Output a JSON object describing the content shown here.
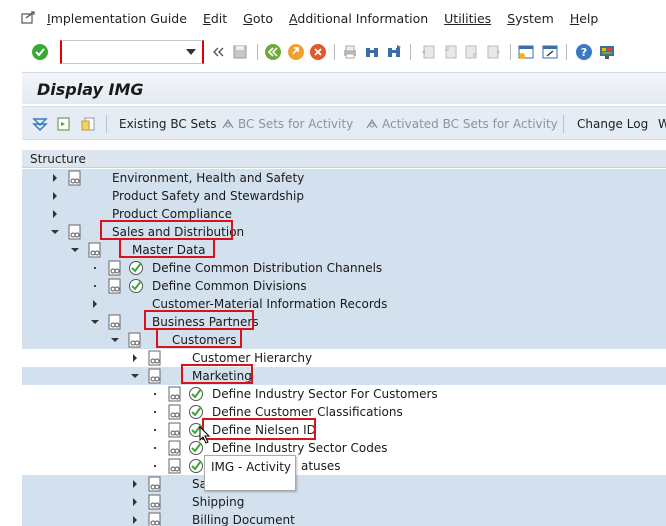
{
  "menubar": {
    "items": [
      {
        "label": "Implementation Guide",
        "ul": "I",
        "rest": "mplementation Guide"
      },
      {
        "label": "Edit",
        "ul": "E",
        "rest": "dit"
      },
      {
        "label": "Goto",
        "ul": "G",
        "rest": "oto"
      },
      {
        "label": "Additional Information",
        "ul": "A",
        "rest": "dditional Information"
      },
      {
        "label": "Utilities",
        "ul": "",
        "rest": "Utilities"
      },
      {
        "label": "System",
        "ul": "S",
        "rest": "ystem"
      },
      {
        "label": "Help",
        "ul": "H",
        "rest": "elp"
      }
    ]
  },
  "toolbar": {
    "command_field_value": "",
    "colors": {
      "enter_green": "#3aa832",
      "back_green": "#6aab3a",
      "exit_orange": "#f0a030",
      "cancel_red": "#e05a2a"
    }
  },
  "title": "Display IMG",
  "app_toolbar": {
    "existing_bc_sets": "Existing BC Sets",
    "bc_sets_for_activity": "BC Sets for Activity",
    "activated_bc_sets": "Activated BC Sets for Activity",
    "change_log": "Change Log",
    "overflow": "W"
  },
  "tree": {
    "header": "Structure",
    "rows": [
      {
        "label": "Environment, Health and Safety"
      },
      {
        "label": "Product Safety and Stewardship"
      },
      {
        "label": "Product Compliance"
      },
      {
        "label": "Sales and Distribution"
      },
      {
        "label": "Master Data"
      },
      {
        "label": "Define Common Distribution Channels"
      },
      {
        "label": "Define Common Divisions"
      },
      {
        "label": "Customer-Material Information Records"
      },
      {
        "label": "Business Partners"
      },
      {
        "label": "Customers"
      },
      {
        "label": "Customer Hierarchy"
      },
      {
        "label": "Marketing"
      },
      {
        "label": "Define Industry Sector For Customers"
      },
      {
        "label": "Define Customer Classifications"
      },
      {
        "label": "Define Nielsen ID"
      },
      {
        "label": "Define Industry Sector Codes"
      },
      {
        "label": "atuses"
      },
      {
        "label": "Sa"
      },
      {
        "label": "Shipping"
      },
      {
        "label": "Billing Document"
      }
    ]
  },
  "tooltip": "IMG - Activity",
  "highlight_color": "#d8131b"
}
